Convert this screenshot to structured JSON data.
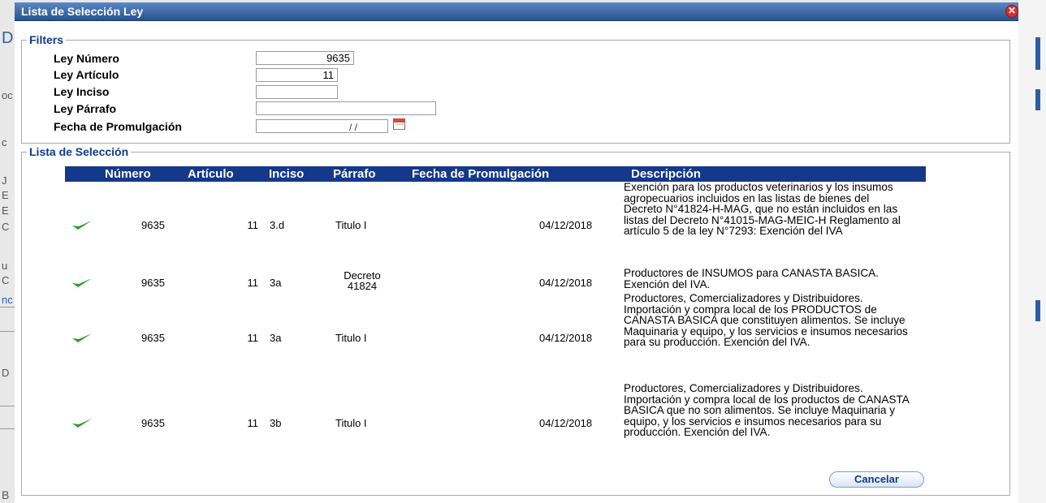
{
  "window": {
    "title": "Lista de Selección Ley",
    "close_glyph": "✕"
  },
  "filters": {
    "legend": "Filters",
    "fields": [
      {
        "label": "Ley Número",
        "value": "9635"
      },
      {
        "label": "Ley Artículo",
        "value": "11"
      },
      {
        "label": "Ley Inciso",
        "value": ""
      },
      {
        "label": "Ley Párrafo",
        "value": ""
      },
      {
        "label": "Fecha de Promulgación",
        "value": "",
        "date_placeholder": "/ /"
      }
    ]
  },
  "selection": {
    "legend": "Lista de Selección",
    "columns": [
      "Número",
      "Artículo",
      "Inciso",
      "Párrafo",
      "Fecha de Promulgación",
      "Descripción"
    ],
    "rows": [
      {
        "numero": "9635",
        "articulo": "11",
        "inciso": "3.d",
        "parrafo": "Titulo I",
        "fecha": "04/12/2018",
        "descripcion": "Exención para los productos veterinarios y los insumos agropecuarios incluidos en las listas de bienes del Decreto N°41824-H-MAG, que no están incluidos en las listas del Decreto N°41015-MAG-MEIC-H Reglamento al artículo 5 de la ley N°7293: Exención del IVA"
      },
      {
        "numero": "9635",
        "articulo": "11",
        "inciso": "3a",
        "parrafo": "Decreto 41824",
        "fecha": "04/12/2018",
        "descripcion": "Productores de INSUMOS para CANASTA BASICA. Exención del IVA."
      },
      {
        "numero": "9635",
        "articulo": "11",
        "inciso": "3a",
        "parrafo": "Titulo I",
        "fecha": "04/12/2018",
        "descripcion": "Productores, Comercializadores y Distribuidores. Importación y compra local de los PRODUCTOS de CANASTA BASICA que constituyen alimentos. Se incluye Maquinaria y equipo, y los servicios e insumos necesarios para su producción. Exención del IVA."
      },
      {
        "numero": "9635",
        "articulo": "11",
        "inciso": "3b",
        "parrafo": "Titulo I",
        "fecha": "04/12/2018",
        "descripcion": "Productores, Comercializadores y Distribuidores. Importación y compra local de los productos de CANASTA BASICA que no son alimentos. Se incluye Maquinaria y equipo, y los servicios e insumos necesarios para su producción. Exención del IVA."
      }
    ]
  },
  "actions": {
    "cancel_label": "Cancelar"
  },
  "background_fragments": [
    "D",
    "oc",
    "c",
    "J",
    "E",
    "E",
    "C",
    "u",
    "C",
    "nc",
    "D",
    "B"
  ],
  "icons": {
    "select_row": "checkmark-icon",
    "calendar": "calendar-icon",
    "close": "close-icon"
  },
  "colors": {
    "titlebar": "#27538f",
    "grid_header": "#14388a",
    "legend_text": "#0f3a87",
    "check": "#2e9a2e",
    "close": "#d9302a"
  }
}
